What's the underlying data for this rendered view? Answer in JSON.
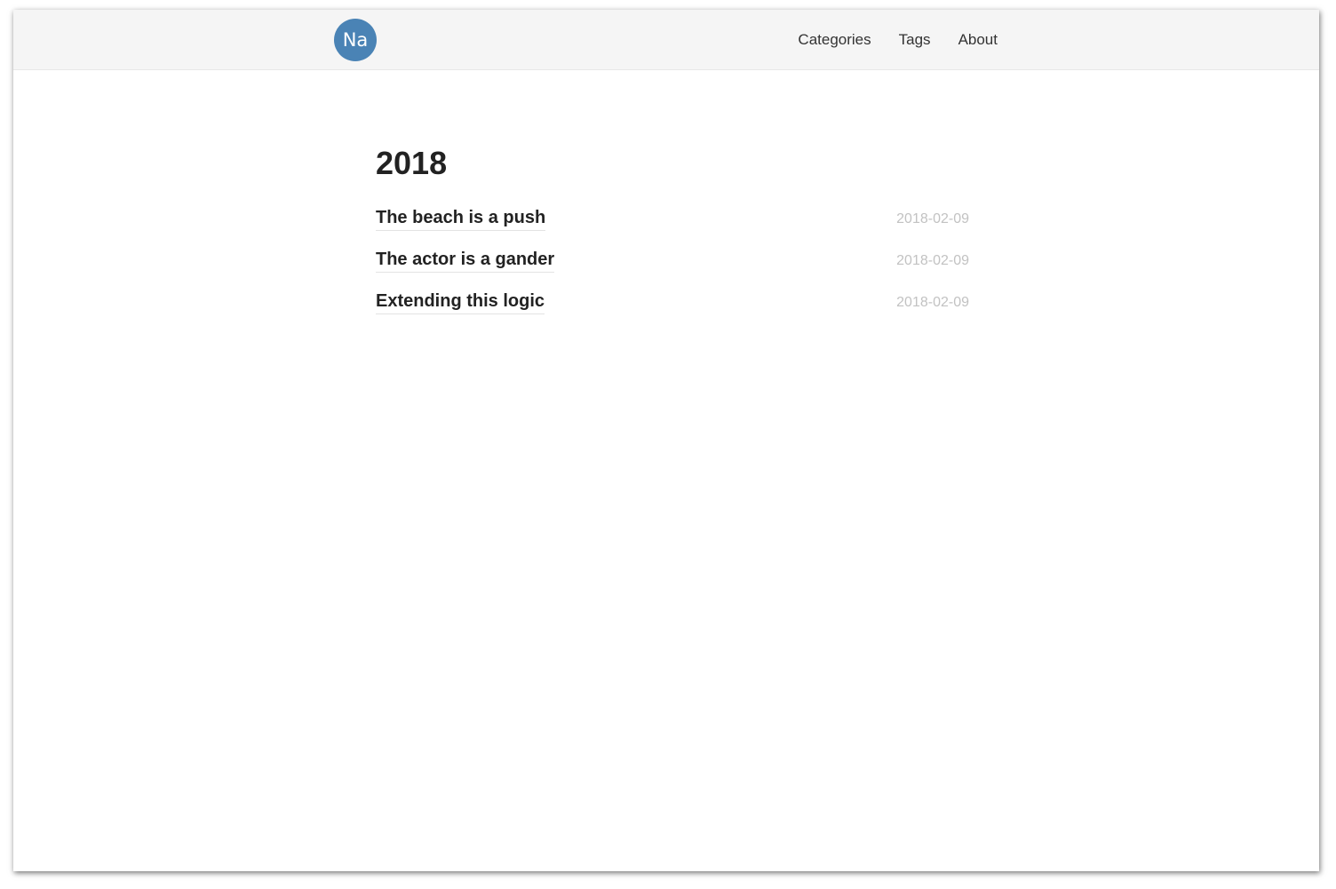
{
  "header": {
    "avatar_text": "Na",
    "nav": [
      {
        "label": "Categories"
      },
      {
        "label": "Tags"
      },
      {
        "label": "About"
      }
    ]
  },
  "archive": {
    "year": "2018",
    "posts": [
      {
        "title": "The beach is a push",
        "date": "2018-02-09"
      },
      {
        "title": "The actor is a gander",
        "date": "2018-02-09"
      },
      {
        "title": "Extending this logic",
        "date": "2018-02-09"
      }
    ]
  },
  "colors": {
    "avatar_bg": "#4a83b5",
    "navbar_bg": "#f5f5f5",
    "date_text": "#c2c2c2"
  }
}
